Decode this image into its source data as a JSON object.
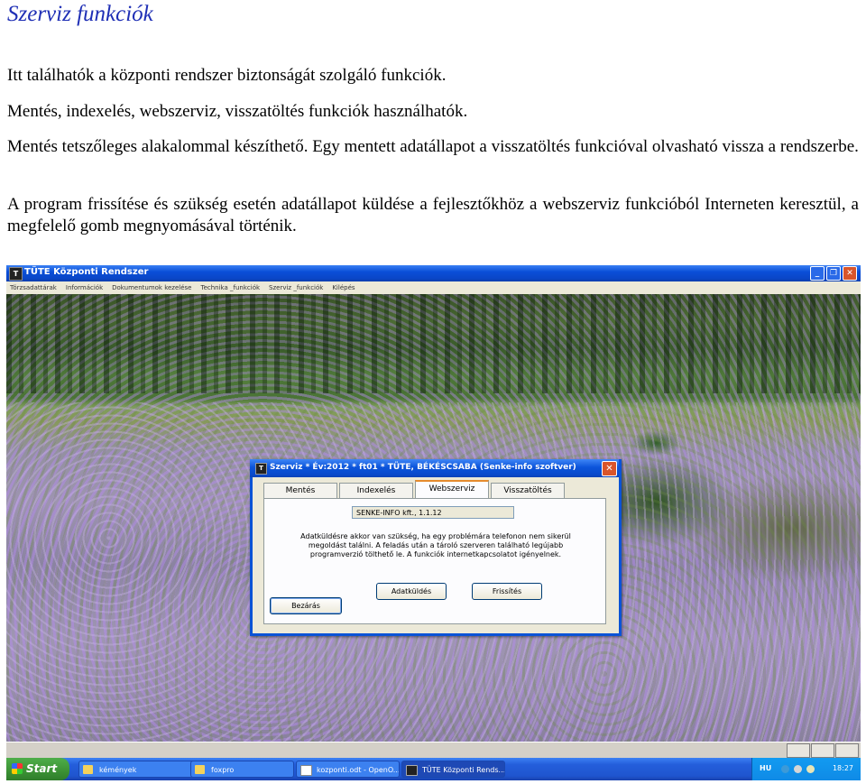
{
  "doc": {
    "title": "Szerviz funkciók",
    "p1": "Itt találhatók a központi rendszer biztonságát szolgáló funkciók.",
    "p2": "Mentés, indexelés, webszerviz, visszatöltés funkciók használhatók.",
    "p3": "Mentés tetszőleges alakalommal készíthető. Egy mentett adatállapot a visszatöltés funkcióval olvasható vissza a rendszerbe.",
    "p4": "A program frissítése és szükség esetén adatállapot küldése a fejlesztőkhöz a webszerviz funkcióból Interneten keresztül, a megfelelő gomb megnyomásával történik."
  },
  "app_window": {
    "title": "TÜTE Központi Rendszer",
    "menu": [
      "Törzsadattárak",
      "Információk",
      "Dokumentumok kezelése",
      "Technika _funkciók",
      "Szerviz _funkciók",
      "Kilépés"
    ]
  },
  "dialog": {
    "title": "Szerviz * Év:2012 * ft01 * TÜTE, BÉKÉSCSABA         (Senke-info szoftver)",
    "tabs": [
      {
        "label": "Mentés",
        "active": false
      },
      {
        "label": "Indexelés",
        "active": false
      },
      {
        "label": "Webszerviz",
        "active": true
      },
      {
        "label": "Visszatöltés",
        "active": false
      }
    ],
    "company_field": "SENKE-INFO kft.,   1.1.12",
    "info_text": "Adatküldésre akkor van szükség, ha egy problémára telefonon nem sikerül megoldást találni. A feladás után a tároló szerveren található legújabb programverzió tölthető le. A funkciók internetkapcsolatot igényelnek.",
    "send_button": "Adatküldés",
    "update_button": "Frissítés",
    "close_button": "Bezárás"
  },
  "taskbar": {
    "start_label": "Start",
    "tasks": [
      "kémények",
      "foxpro",
      "kozponti.odt - OpenO...",
      "TÜTE Központi Rends..."
    ],
    "language": "HU",
    "clock": "18:27"
  }
}
